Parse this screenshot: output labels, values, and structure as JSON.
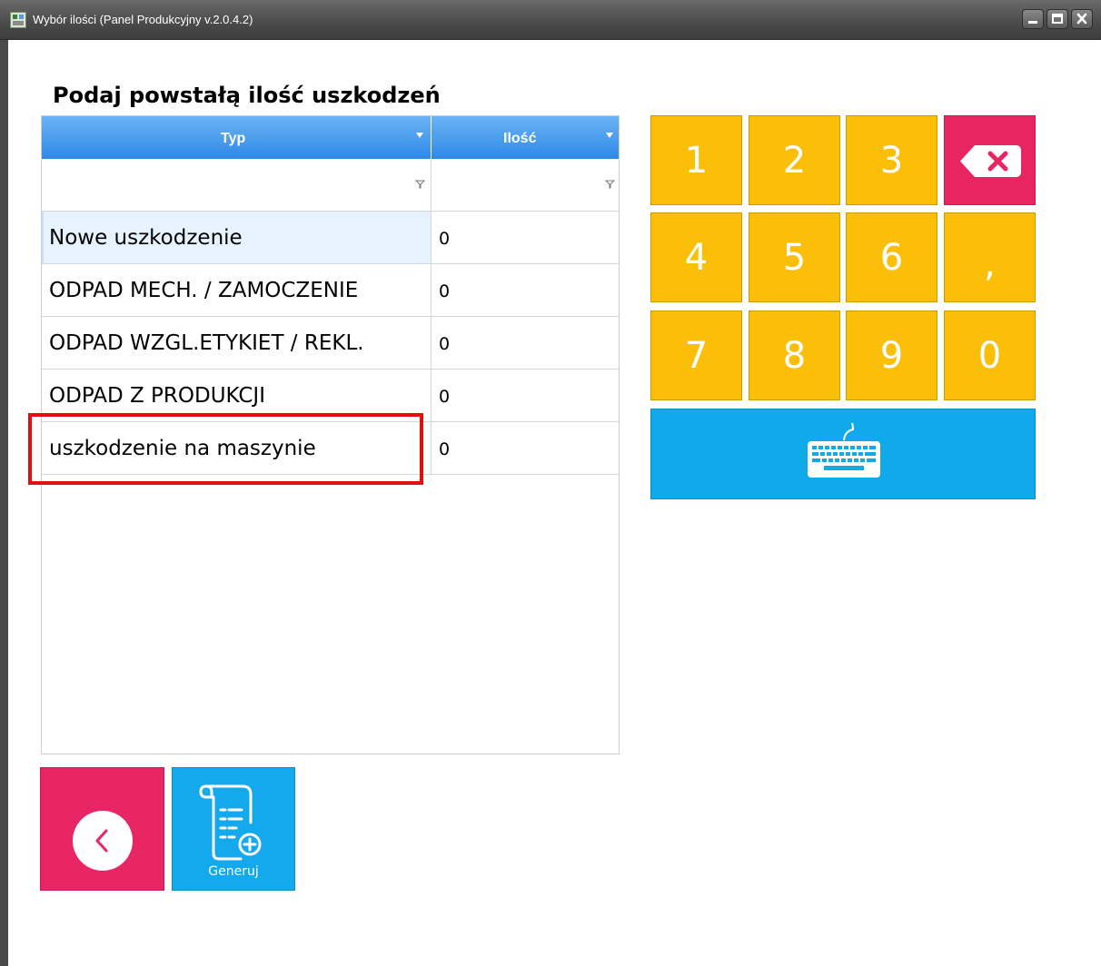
{
  "window": {
    "title": "Wybór ilości (Panel Produkcyjny v.2.0.4.2)",
    "icons": {
      "app": "app-icon",
      "minimize": "minimize-icon",
      "maximize": "maximize-icon",
      "close": "close-icon"
    }
  },
  "heading": "Podaj powstałą ilość uszkodzeń",
  "grid": {
    "columns": [
      "Typ",
      "Ilość"
    ],
    "rows": [
      {
        "typ": "Nowe uszkodzenie",
        "ilosc": "0"
      },
      {
        "typ": "ODPAD MECH. / ZAMOCZENIE",
        "ilosc": "0"
      },
      {
        "typ": "ODPAD WZGL.ETYKIET / REKL.",
        "ilosc": "0"
      },
      {
        "typ": "ODPAD Z PRODUKCJI",
        "ilosc": "0"
      },
      {
        "typ": "uszkodzenie na maszynie",
        "ilosc": "0"
      }
    ],
    "header_color": "#2f89e6"
  },
  "keypad": {
    "keys": [
      "1",
      "2",
      "3",
      "4",
      "5",
      "6",
      ",",
      "7",
      "8",
      "9",
      "0"
    ],
    "backspace_icon": "backspace-icon",
    "keyboard_icon": "keyboard-icon",
    "key_color": "#fbbf0a",
    "backspace_color": "#e82560",
    "keyboard_color": "#10aaeb"
  },
  "buttons": {
    "back_icon": "chevron-left-icon",
    "generate_label": "Generuj",
    "generate_icon": "scroll-add-icon",
    "back_color": "#e82565",
    "generate_color": "#14a9ec"
  },
  "highlight_color": "#e11010"
}
